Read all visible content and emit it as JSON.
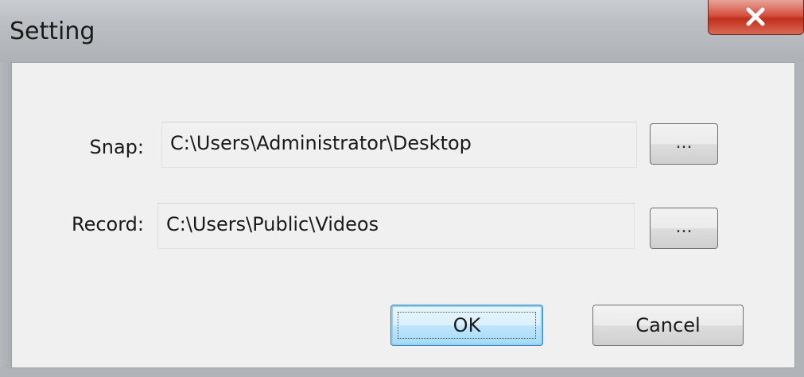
{
  "window": {
    "title": "Setting"
  },
  "snap": {
    "label": "Snap:",
    "path": "C:\\Users\\Administrator\\Desktop",
    "browse_label": "..."
  },
  "record": {
    "label": "Record:",
    "path": "C:\\Users\\Public\\Videos",
    "browse_label": "..."
  },
  "buttons": {
    "ok_label": "OK",
    "cancel_label": "Cancel"
  },
  "icons": {
    "close": "close-icon"
  },
  "colors": {
    "close_button": "#c1301c",
    "default_button_border": "#3c7fb1",
    "client_bg": "#f0f0f0"
  }
}
